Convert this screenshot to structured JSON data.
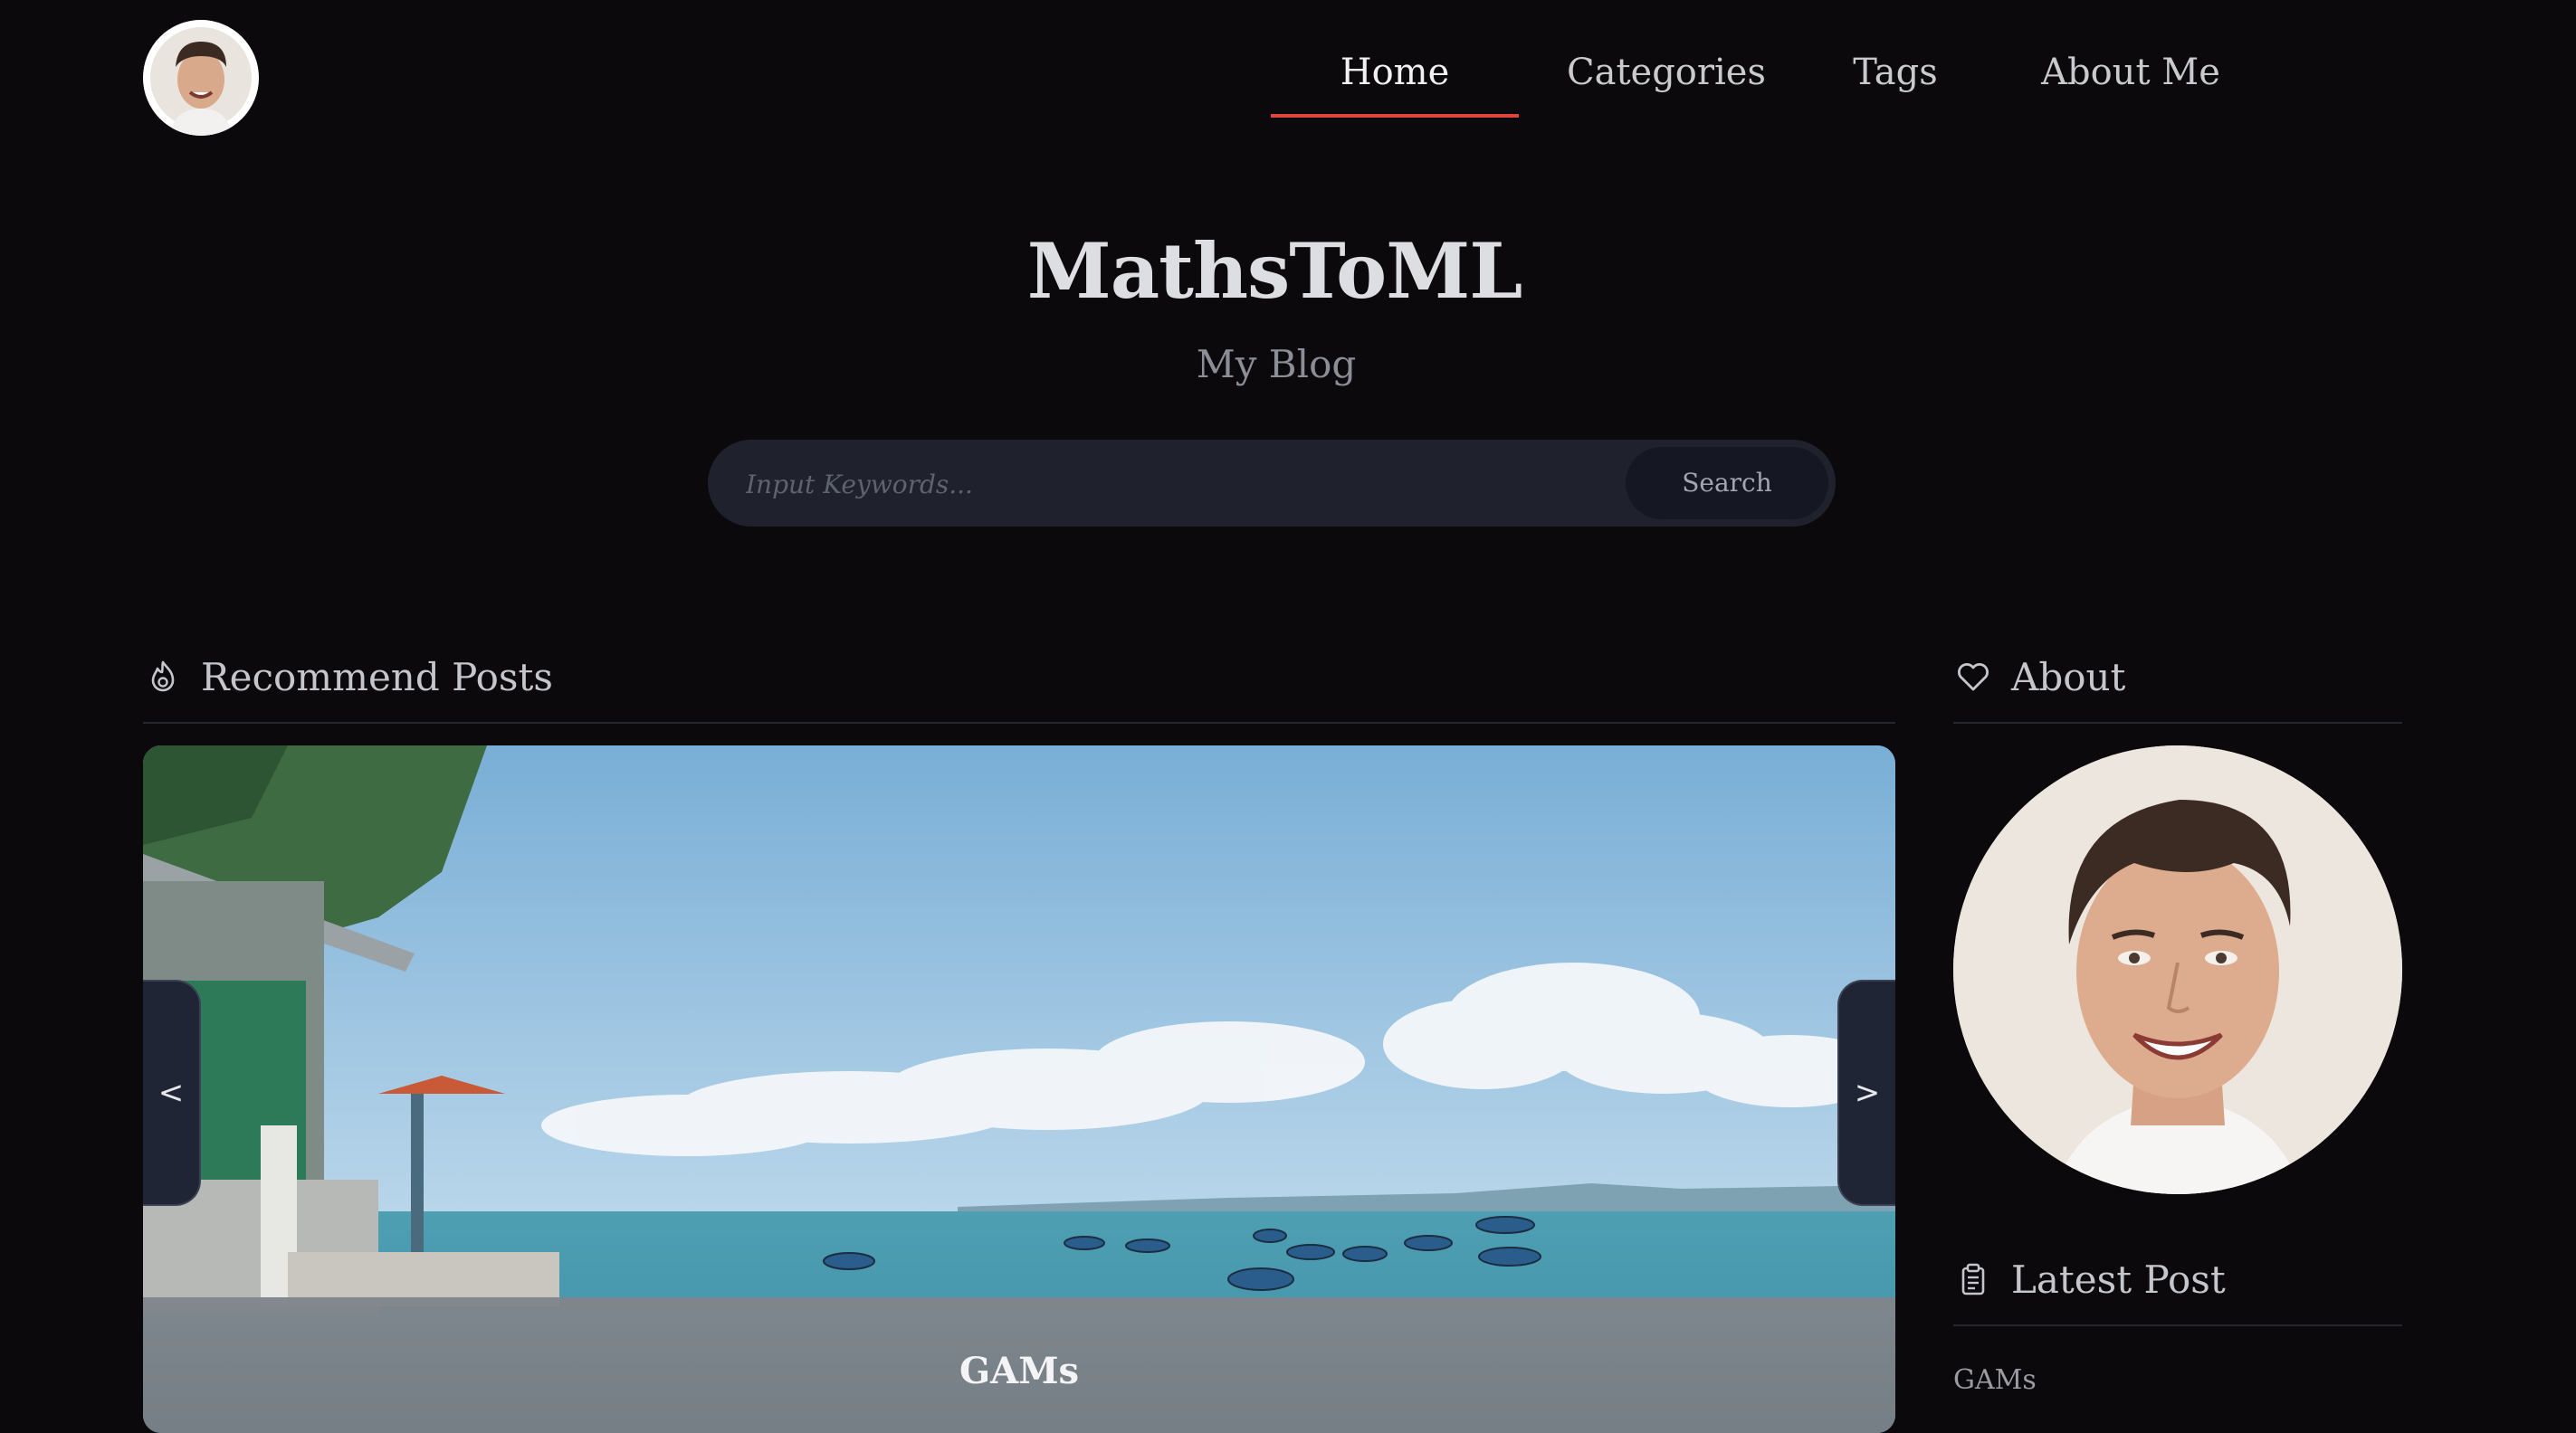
{
  "nav": {
    "items": [
      {
        "label": "Home",
        "active": true
      },
      {
        "label": "Categories",
        "active": false
      },
      {
        "label": "Tags",
        "active": false
      },
      {
        "label": "About Me",
        "active": false
      }
    ]
  },
  "site": {
    "title": "MathsToML",
    "subtitle": "My Blog"
  },
  "search": {
    "placeholder": "Input Keywords...",
    "value": "",
    "button_label": "Search"
  },
  "recommend": {
    "heading": "Recommend Posts",
    "icon": "fire-icon",
    "current_post_title": "GAMs",
    "prev_label": "<",
    "next_label": ">"
  },
  "about": {
    "heading": "About",
    "icon": "heart-icon"
  },
  "latest": {
    "heading": "Latest Post",
    "icon": "clipboard-icon",
    "posts": [
      {
        "title": "GAMs"
      }
    ]
  },
  "colors": {
    "background": "#0b090c",
    "accent": "#e0453b",
    "search_bg": "#1f222d"
  }
}
